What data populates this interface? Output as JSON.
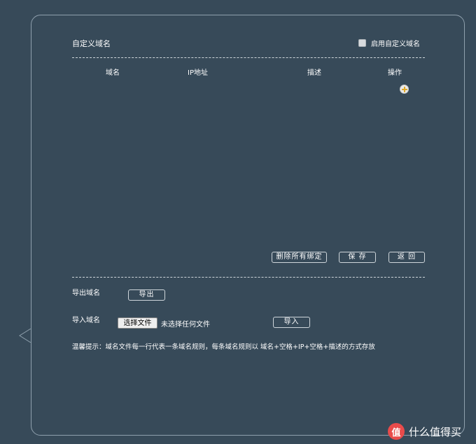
{
  "header": {
    "title": "自定义域名",
    "enable_label": "启用自定义域名",
    "enable_checked": false
  },
  "table": {
    "columns": [
      "域名",
      "IP地址",
      "描述",
      "操作"
    ],
    "rows": []
  },
  "actions": {
    "delete_all": "删除所有绑定",
    "save": "保 存",
    "back": "返 回"
  },
  "export": {
    "label": "导出域名",
    "button": "导出"
  },
  "import": {
    "label": "导入域名",
    "choose_file": "选择文件",
    "file_status": "未选择任何文件",
    "button": "导入"
  },
  "tip": "温馨提示：域名文件每一行代表一条域名规则，每条域名规则以 域名+空格+IP+空格+描述的方式存放",
  "watermark": {
    "logo": "值",
    "text": "什么值得买"
  },
  "colors": {
    "background": "#374a59",
    "add_icon_plus": "#e0a92a",
    "watermark_logo": "#e94b4b"
  }
}
